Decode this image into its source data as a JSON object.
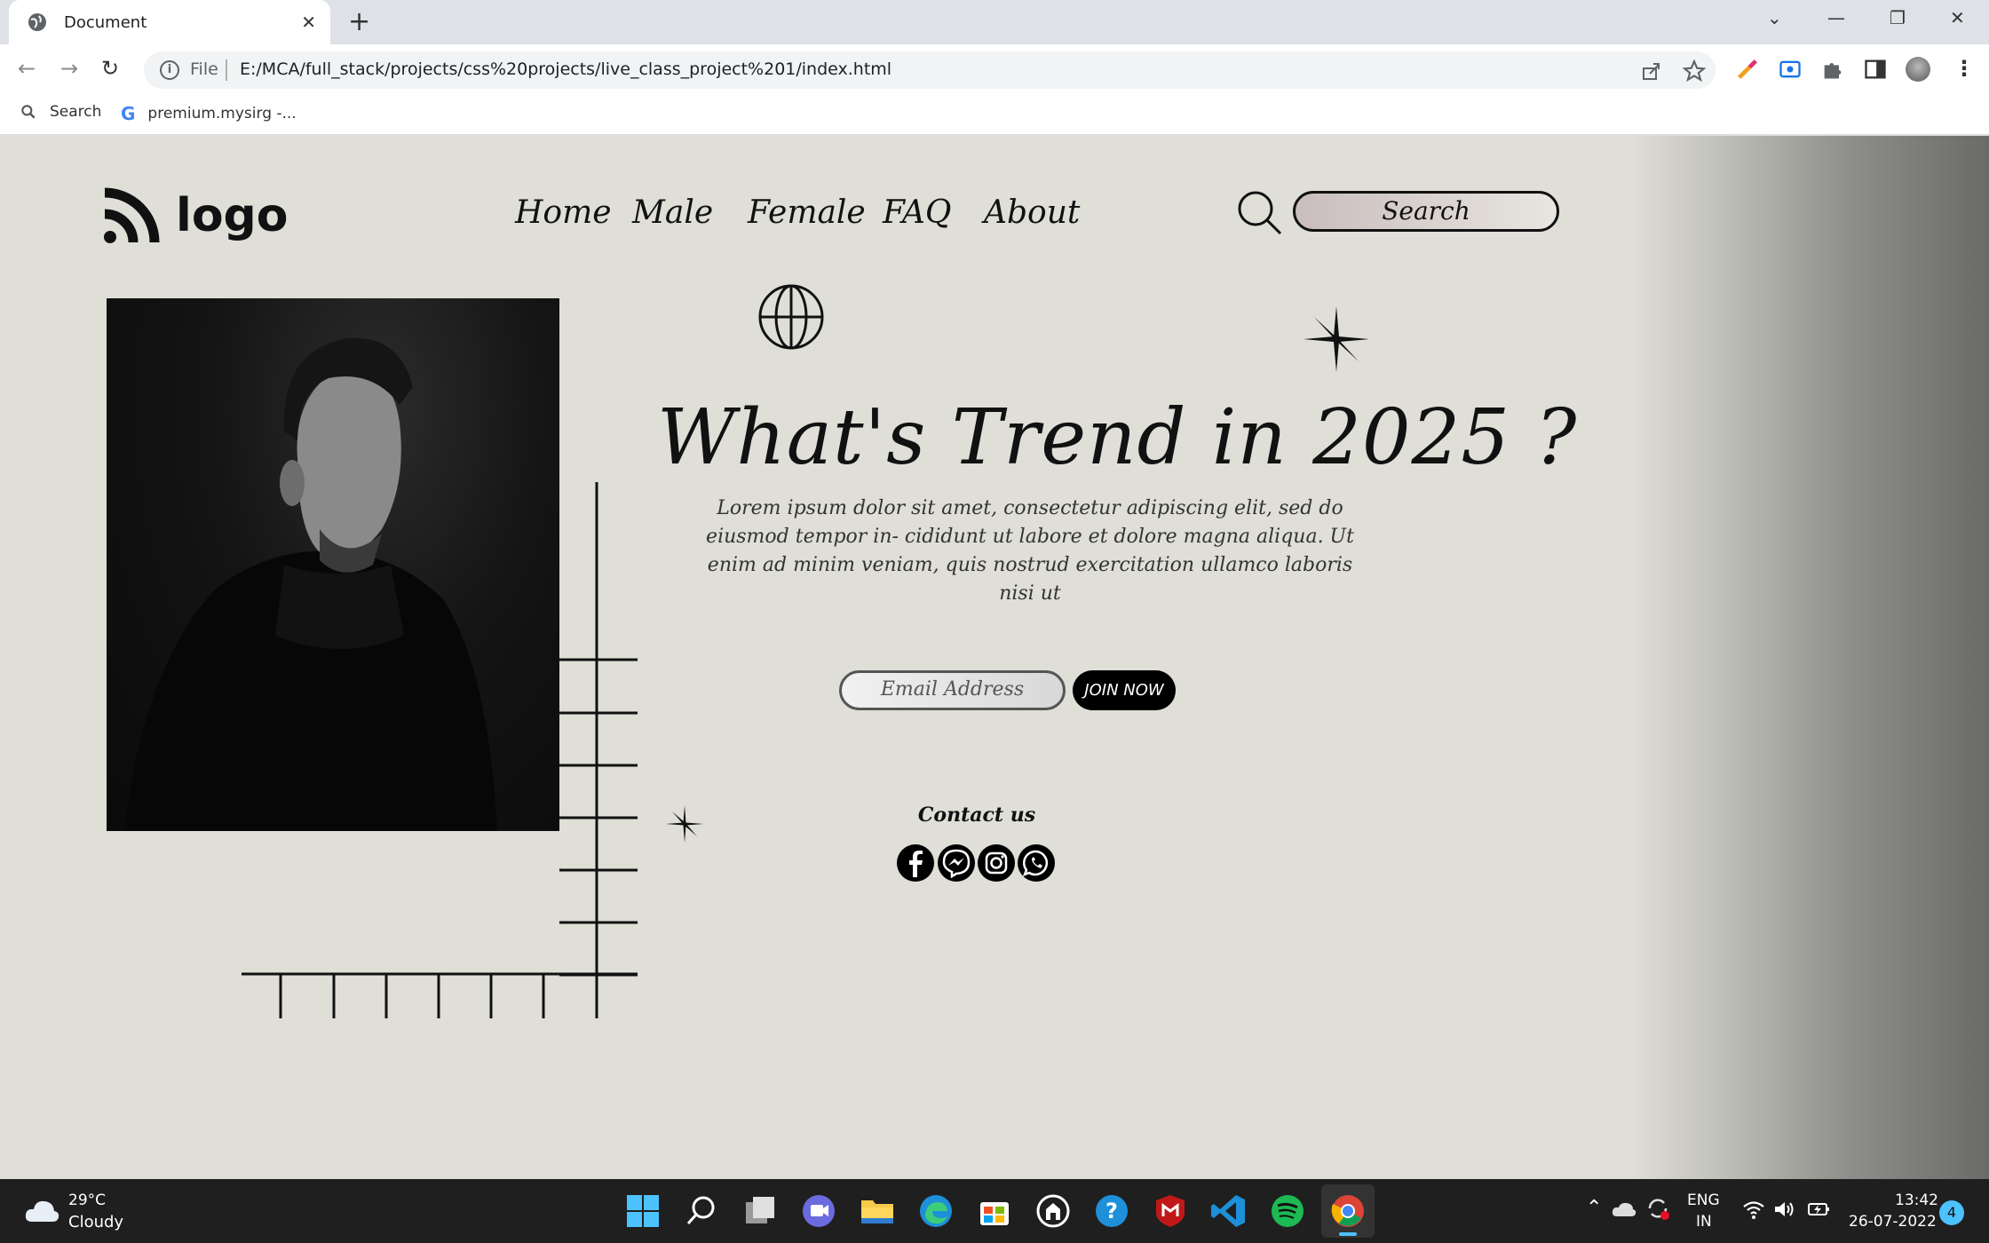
{
  "browser": {
    "tab_title": "Document",
    "url_scheme": "File",
    "url": "E:/MCA/full_stack/projects/css%20projects/live_class_project%201/index.html",
    "bookmarks": [
      {
        "label": "Search",
        "icon": "search-icon"
      },
      {
        "label": "premium.mysirg -...",
        "icon": "google-icon"
      }
    ]
  },
  "site": {
    "logo_text": "logo",
    "nav": [
      "Home",
      "Male",
      "Female",
      "FAQ",
      "About"
    ],
    "search_placeholder": "Search",
    "headline": "What's Trend in 2025 ?",
    "description": "Lorem ipsum dolor sit amet, consectetur adipiscing elit, sed do eiusmod tempor in- cididunt ut labore et dolore magna aliqua. Ut enim ad minim veniam, quis nostrud exercitation ullamco laboris nisi ut",
    "email_placeholder": "Email Address",
    "join_label": "JOIN NOW",
    "contact_label": "Contact us",
    "social": [
      "facebook-icon",
      "messenger-icon",
      "instagram-icon",
      "whatsapp-icon"
    ]
  },
  "taskbar": {
    "weather_temp": "29°C",
    "weather_desc": "Cloudy",
    "lang_top": "ENG",
    "lang_bottom": "IN",
    "time": "13:42",
    "date": "26-07-2022",
    "notification_count": "4"
  },
  "colors": {
    "page_bg": "#dfded7",
    "accent_dark": "#111111",
    "taskbar_bg": "#1f1f1f"
  }
}
